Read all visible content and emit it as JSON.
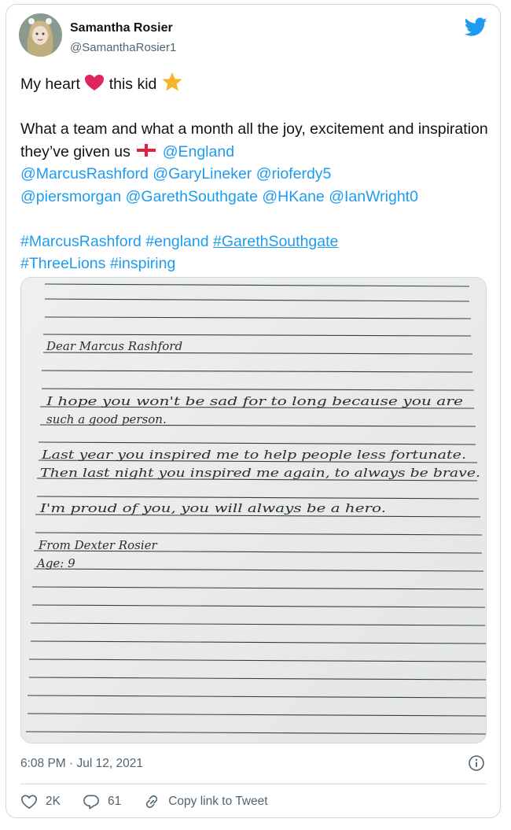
{
  "tweet": {
    "author": {
      "display_name": "Samantha Rosier",
      "handle": "@SamanthaRosier1"
    },
    "line1_a": "My heart",
    "line1_b": "this kid",
    "body_plain": "What a team and what a month all the joy, excitement and inspiration they’ve given us",
    "mentions": [
      "@England",
      "@MarcusRashford",
      "@GaryLineker",
      "@rioferdy5",
      "@piersmorgan",
      "@GarethSouthgate",
      "@HKane",
      "@IanWright0"
    ],
    "hashtags": [
      "#MarcusRashford",
      "#england",
      "#GarethSouthgate",
      "#ThreeLions",
      "#inspiring"
    ],
    "timestamp": "6:08 PM · Jul 12, 2021",
    "likes": "2K",
    "replies": "61",
    "copy_link": "Copy link to Tweet"
  },
  "letter": {
    "salutation": "Dear Marcus Rashford",
    "para1_l1": "I hope you won't be sad for to long because you are",
    "para1_l2": "such a good person.",
    "para2_l1": "Last year you inspired me to help people less fortunate.",
    "para2_l2": "Then last night you inspired me again, to always be brave.",
    "para3": "I'm proud of you, you will always be a hero.",
    "from": "From Dexter Rosier",
    "age": "Age: 9"
  },
  "colors": {
    "link": "#1d9bf0",
    "heart": "#e0245e",
    "secondary_text": "#536471",
    "twitter_blue": "#1d9bf0"
  },
  "icons": [
    "twitter-bird-icon",
    "red-heart-icon",
    "star-icon",
    "england-flag-icon",
    "info-icon",
    "like-icon",
    "reply-icon",
    "link-icon"
  ]
}
